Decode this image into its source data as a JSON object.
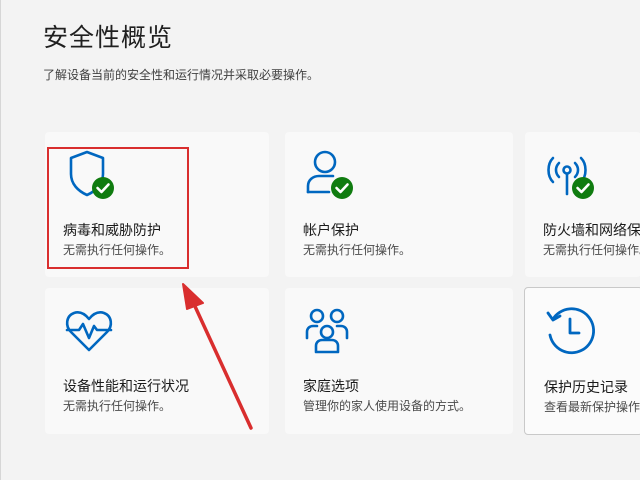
{
  "page": {
    "title": "安全性概览",
    "subtitle": "了解设备当前的安全性和运行情况并采取必要操作。"
  },
  "tiles": [
    {
      "label": "病毒和威胁防护",
      "status": "无需执行任何操作。",
      "icon": "shield-check-icon"
    },
    {
      "label": "帐户保护",
      "status": "无需执行任何操作。",
      "icon": "person-check-icon"
    },
    {
      "label": "防火墙和网络保",
      "status": "无需执行任何操作。",
      "icon": "wifi-antenna-check-icon"
    },
    {
      "label": "设备性能和运行状况",
      "status": "无需执行任何操作。",
      "icon": "heart-pulse-icon"
    },
    {
      "label": "家庭选项",
      "status": "管理你的家人使用设备的方式。",
      "icon": "family-icon"
    },
    {
      "label": "保护历史记录",
      "status": "查看最新保护操作",
      "icon": "history-clock-icon"
    }
  ],
  "colors": {
    "accent": "#0067c0",
    "check": "#107c10",
    "highlight": "#d92e2e"
  }
}
